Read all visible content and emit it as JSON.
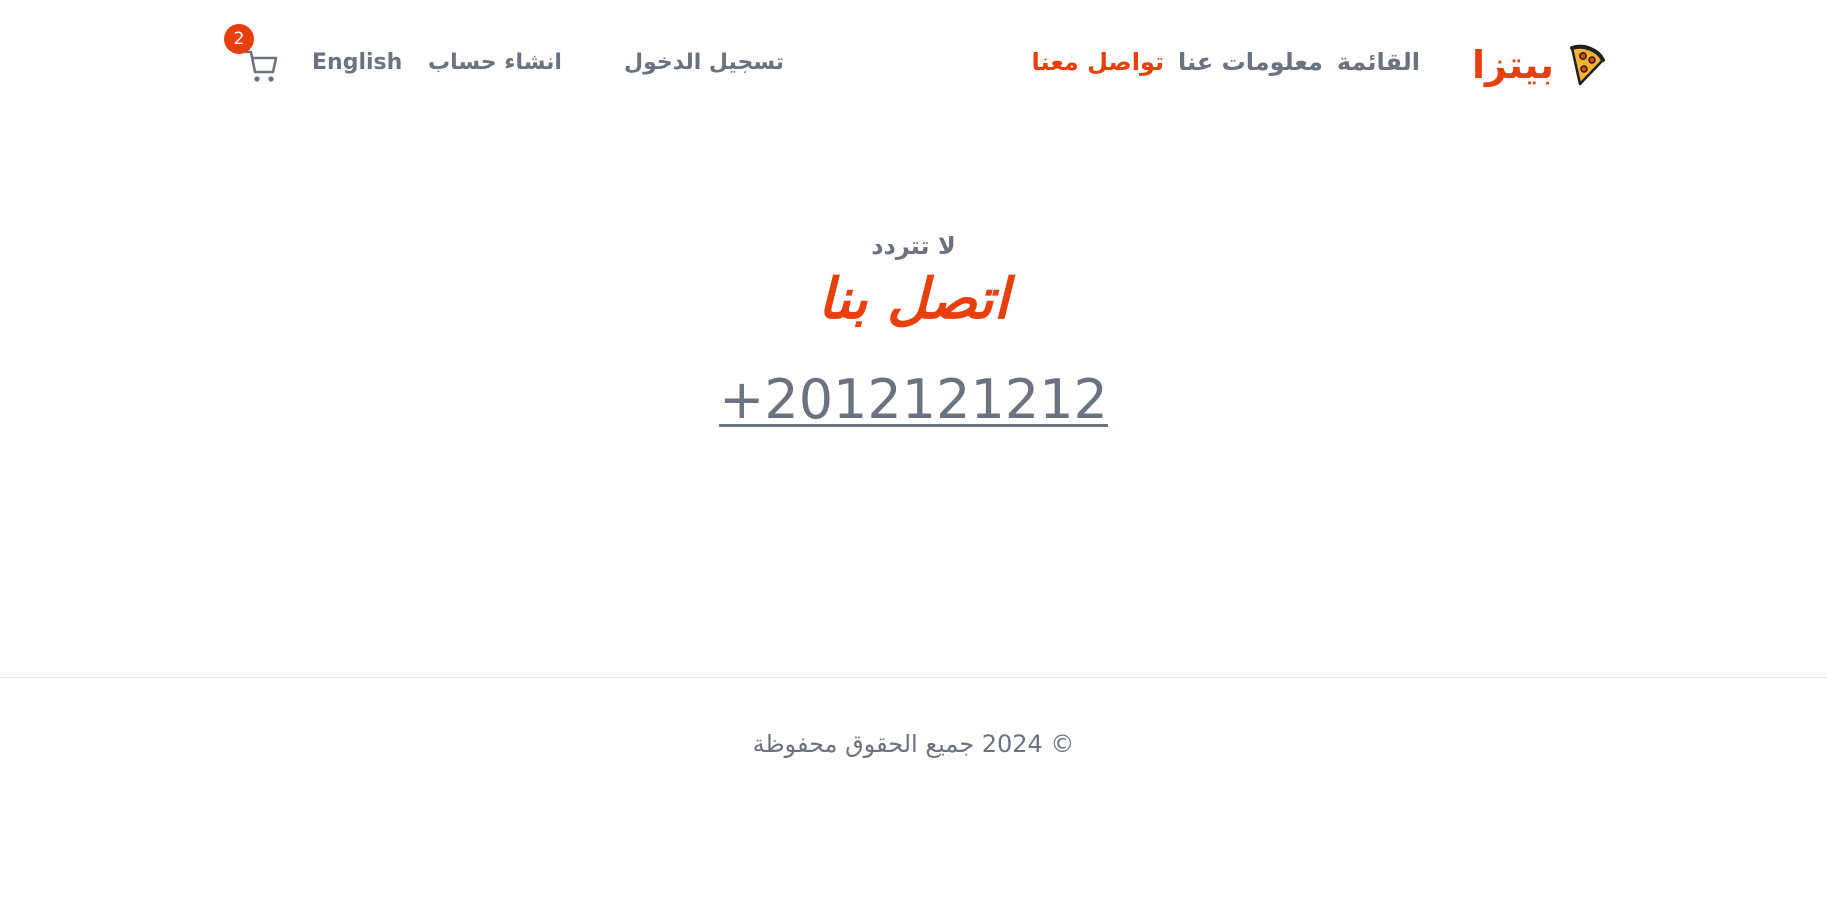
{
  "header": {
    "logo_text": "بيتزا",
    "logo_icon": "pizza-slice-icon",
    "nav": [
      {
        "label": "القائمة",
        "active": false
      },
      {
        "label": "معلومات عنا",
        "active": false
      },
      {
        "label": "تواصل معنا",
        "active": true
      }
    ],
    "login_label": "تسجيل الدخول",
    "signup_label": "انشاء حساب",
    "language_label": "English",
    "cart_icon": "cart-icon",
    "cart_count": "2"
  },
  "main": {
    "eyebrow": "لا تتردد",
    "title": "اتصل بنا",
    "phone": "+2012121212"
  },
  "footer": {
    "copyright": "© 2024 جميع الحقوق محفوظة"
  },
  "colors": {
    "accent": "#e8400c",
    "text_muted": "#6b7280",
    "divider": "#e5e7eb",
    "background": "#ffffff"
  }
}
